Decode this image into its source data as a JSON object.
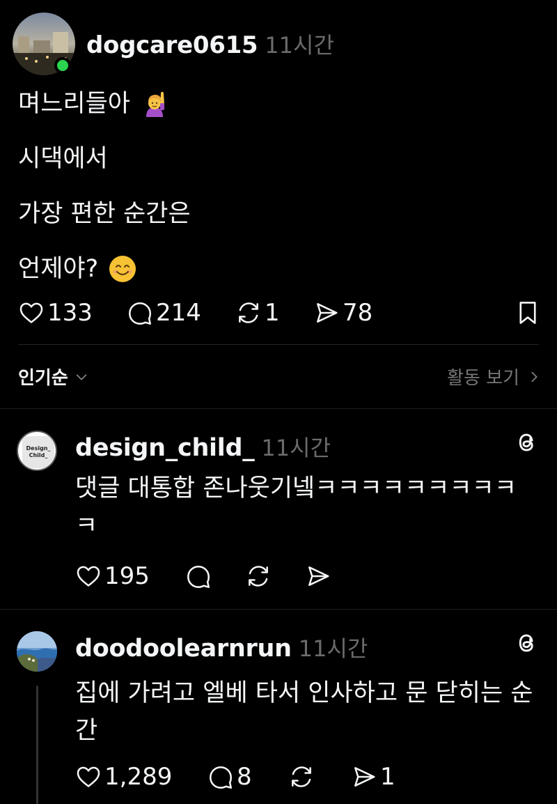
{
  "post": {
    "username": "dogcare0615",
    "time": "11시간",
    "lines": [
      "며느리들아",
      "시댁에서",
      "가장 편한 순간은",
      "언제야?"
    ],
    "emojis": [
      "raising-hand-emoji",
      "smiling-face-emoji"
    ],
    "likes": "133",
    "comments": "214",
    "reposts": "1",
    "shares": "78"
  },
  "sort": {
    "label": "인기순",
    "activity_label": "활동 보기"
  },
  "replies": [
    {
      "username": "design_child_",
      "time": "11시간",
      "avatar_text_line1": "Design_",
      "avatar_text_line2": "Child_",
      "text": "댓글 대통합 존나웃기넼ㅋㅋㅋㅋㅋㅋㅋㅋㅋㅋ",
      "likes": "195",
      "comments": "",
      "reposts": "",
      "shares": ""
    },
    {
      "username": "doodoolearnrun",
      "time": "11시간",
      "text": "집에 가려고 엘베 타서 인사하고 문 닫히는 순간",
      "likes": "1,289",
      "comments": "8",
      "reposts": "",
      "shares": "1"
    }
  ],
  "colors": {
    "background": "#000000",
    "text": "#f3f5f7",
    "muted": "#6b6b6b",
    "online": "#2bd34e"
  }
}
